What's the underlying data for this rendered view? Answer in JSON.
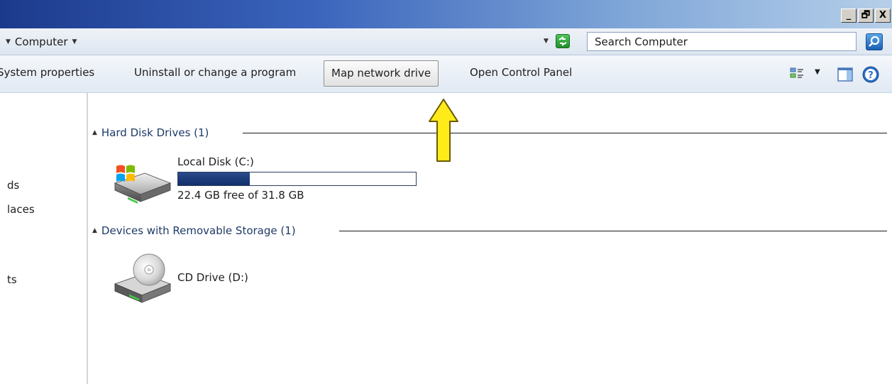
{
  "window": {
    "controls": {
      "minimize": "_",
      "maximize": "🗗",
      "close": "X"
    }
  },
  "address": {
    "path": "Computer",
    "search_placeholder": "Search Computer"
  },
  "toolbar": {
    "system_properties": "System properties",
    "uninstall": "Uninstall or change a program",
    "map_network_drive": "Map network drive",
    "open_control_panel": "Open Control Panel"
  },
  "nav": {
    "items": [
      "ds",
      "laces",
      "ts"
    ]
  },
  "groups": {
    "hard_disk": {
      "title": "Hard Disk Drives (1)",
      "drive": {
        "name": "Local Disk (C:)",
        "free_text": "22.4 GB free of 31.8 GB",
        "used_fraction": 0.3
      }
    },
    "removable": {
      "title": "Devices with Removable Storage (1)",
      "drive": {
        "name": "CD Drive (D:)"
      }
    }
  },
  "colors": {
    "accent": "#1c3a8c",
    "arrow": "#ffeb1a",
    "bar_fill": "#1e3d7b"
  },
  "icons": [
    "refresh-icon",
    "search-icon",
    "view-options-icon",
    "preview-pane-icon",
    "help-icon",
    "hard-disk-icon",
    "cd-drive-icon",
    "pointer-arrow-icon"
  ]
}
